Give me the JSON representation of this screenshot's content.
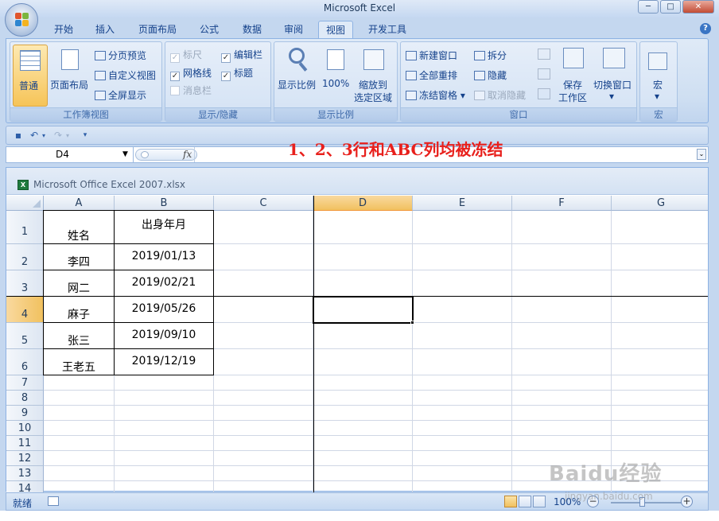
{
  "window": {
    "title": "Microsoft Excel",
    "minimize": "─",
    "maximize": "□",
    "close": "✕"
  },
  "tabs": [
    {
      "label": "开始"
    },
    {
      "label": "插入"
    },
    {
      "label": "页面布局"
    },
    {
      "label": "公式"
    },
    {
      "label": "数据"
    },
    {
      "label": "审阅"
    },
    {
      "label": "视图",
      "active": true
    },
    {
      "label": "开发工具"
    }
  ],
  "help_label": "?",
  "ribbon": {
    "workbook_views": {
      "label": "工作簿视图",
      "normal": "普通",
      "page_layout": "页面布局",
      "page_break": "分页预览",
      "custom_views": "自定义视图",
      "full_screen": "全屏显示"
    },
    "show_hide": {
      "label": "显示/隐藏",
      "ruler": "标尺",
      "formula_bar": "编辑栏",
      "gridlines": "网格线",
      "headings": "标题",
      "message_bar": "消息栏"
    },
    "zoom": {
      "label": "显示比例",
      "zoom": "显示比例",
      "zoom100": "100%",
      "zoom_selection_1": "缩放到",
      "zoom_selection_2": "选定区域"
    },
    "window": {
      "label": "窗口",
      "new_window": "新建窗口",
      "arrange_all": "全部重排",
      "freeze_panes": "冻结窗格",
      "split": "拆分",
      "hide": "隐藏",
      "unhide": "取消隐藏",
      "save_workspace_1": "保存",
      "save_workspace_2": "工作区",
      "switch_windows": "切换窗口"
    },
    "macros": {
      "label": "宏",
      "macros": "宏"
    }
  },
  "formula_bar": {
    "name_box": "D4",
    "fx": "fx",
    "content": ""
  },
  "annotation": "1、2、3行和ABC列均被冻结",
  "workbook": {
    "title": "Microsoft Office Excel 2007.xlsx"
  },
  "sheet": {
    "columns": [
      "A",
      "B",
      "C",
      "D",
      "E",
      "F",
      "G"
    ],
    "selected_column": "D",
    "rows": [
      "1",
      "2",
      "3",
      "4",
      "5",
      "6",
      "7",
      "8",
      "9",
      "10",
      "11",
      "12",
      "13",
      "14"
    ],
    "selected_row": "4",
    "cells": [
      {
        "a": "姓名",
        "b": "出身年月"
      },
      {
        "a": "李四",
        "b": "2019/01/13"
      },
      {
        "a": "网二",
        "b": "2019/02/21"
      },
      {
        "a": "麻子",
        "b": "2019/05/26"
      },
      {
        "a": "张三",
        "b": "2019/09/10"
      },
      {
        "a": "王老五",
        "b": "2019/12/19"
      }
    ],
    "active_cell": "D4",
    "frozen": {
      "rows": 3,
      "columns": 3
    }
  },
  "status": {
    "ready": "就绪",
    "zoom": "100%",
    "zoom_out": "−",
    "zoom_in": "+"
  },
  "watermark": {
    "text": "Baidu经验",
    "sub": "jingyan.baidu.com"
  },
  "colors": {
    "annotation": "#e8201c",
    "ribbon": "#dfeaf7",
    "selected_header": "#f1c15f"
  }
}
